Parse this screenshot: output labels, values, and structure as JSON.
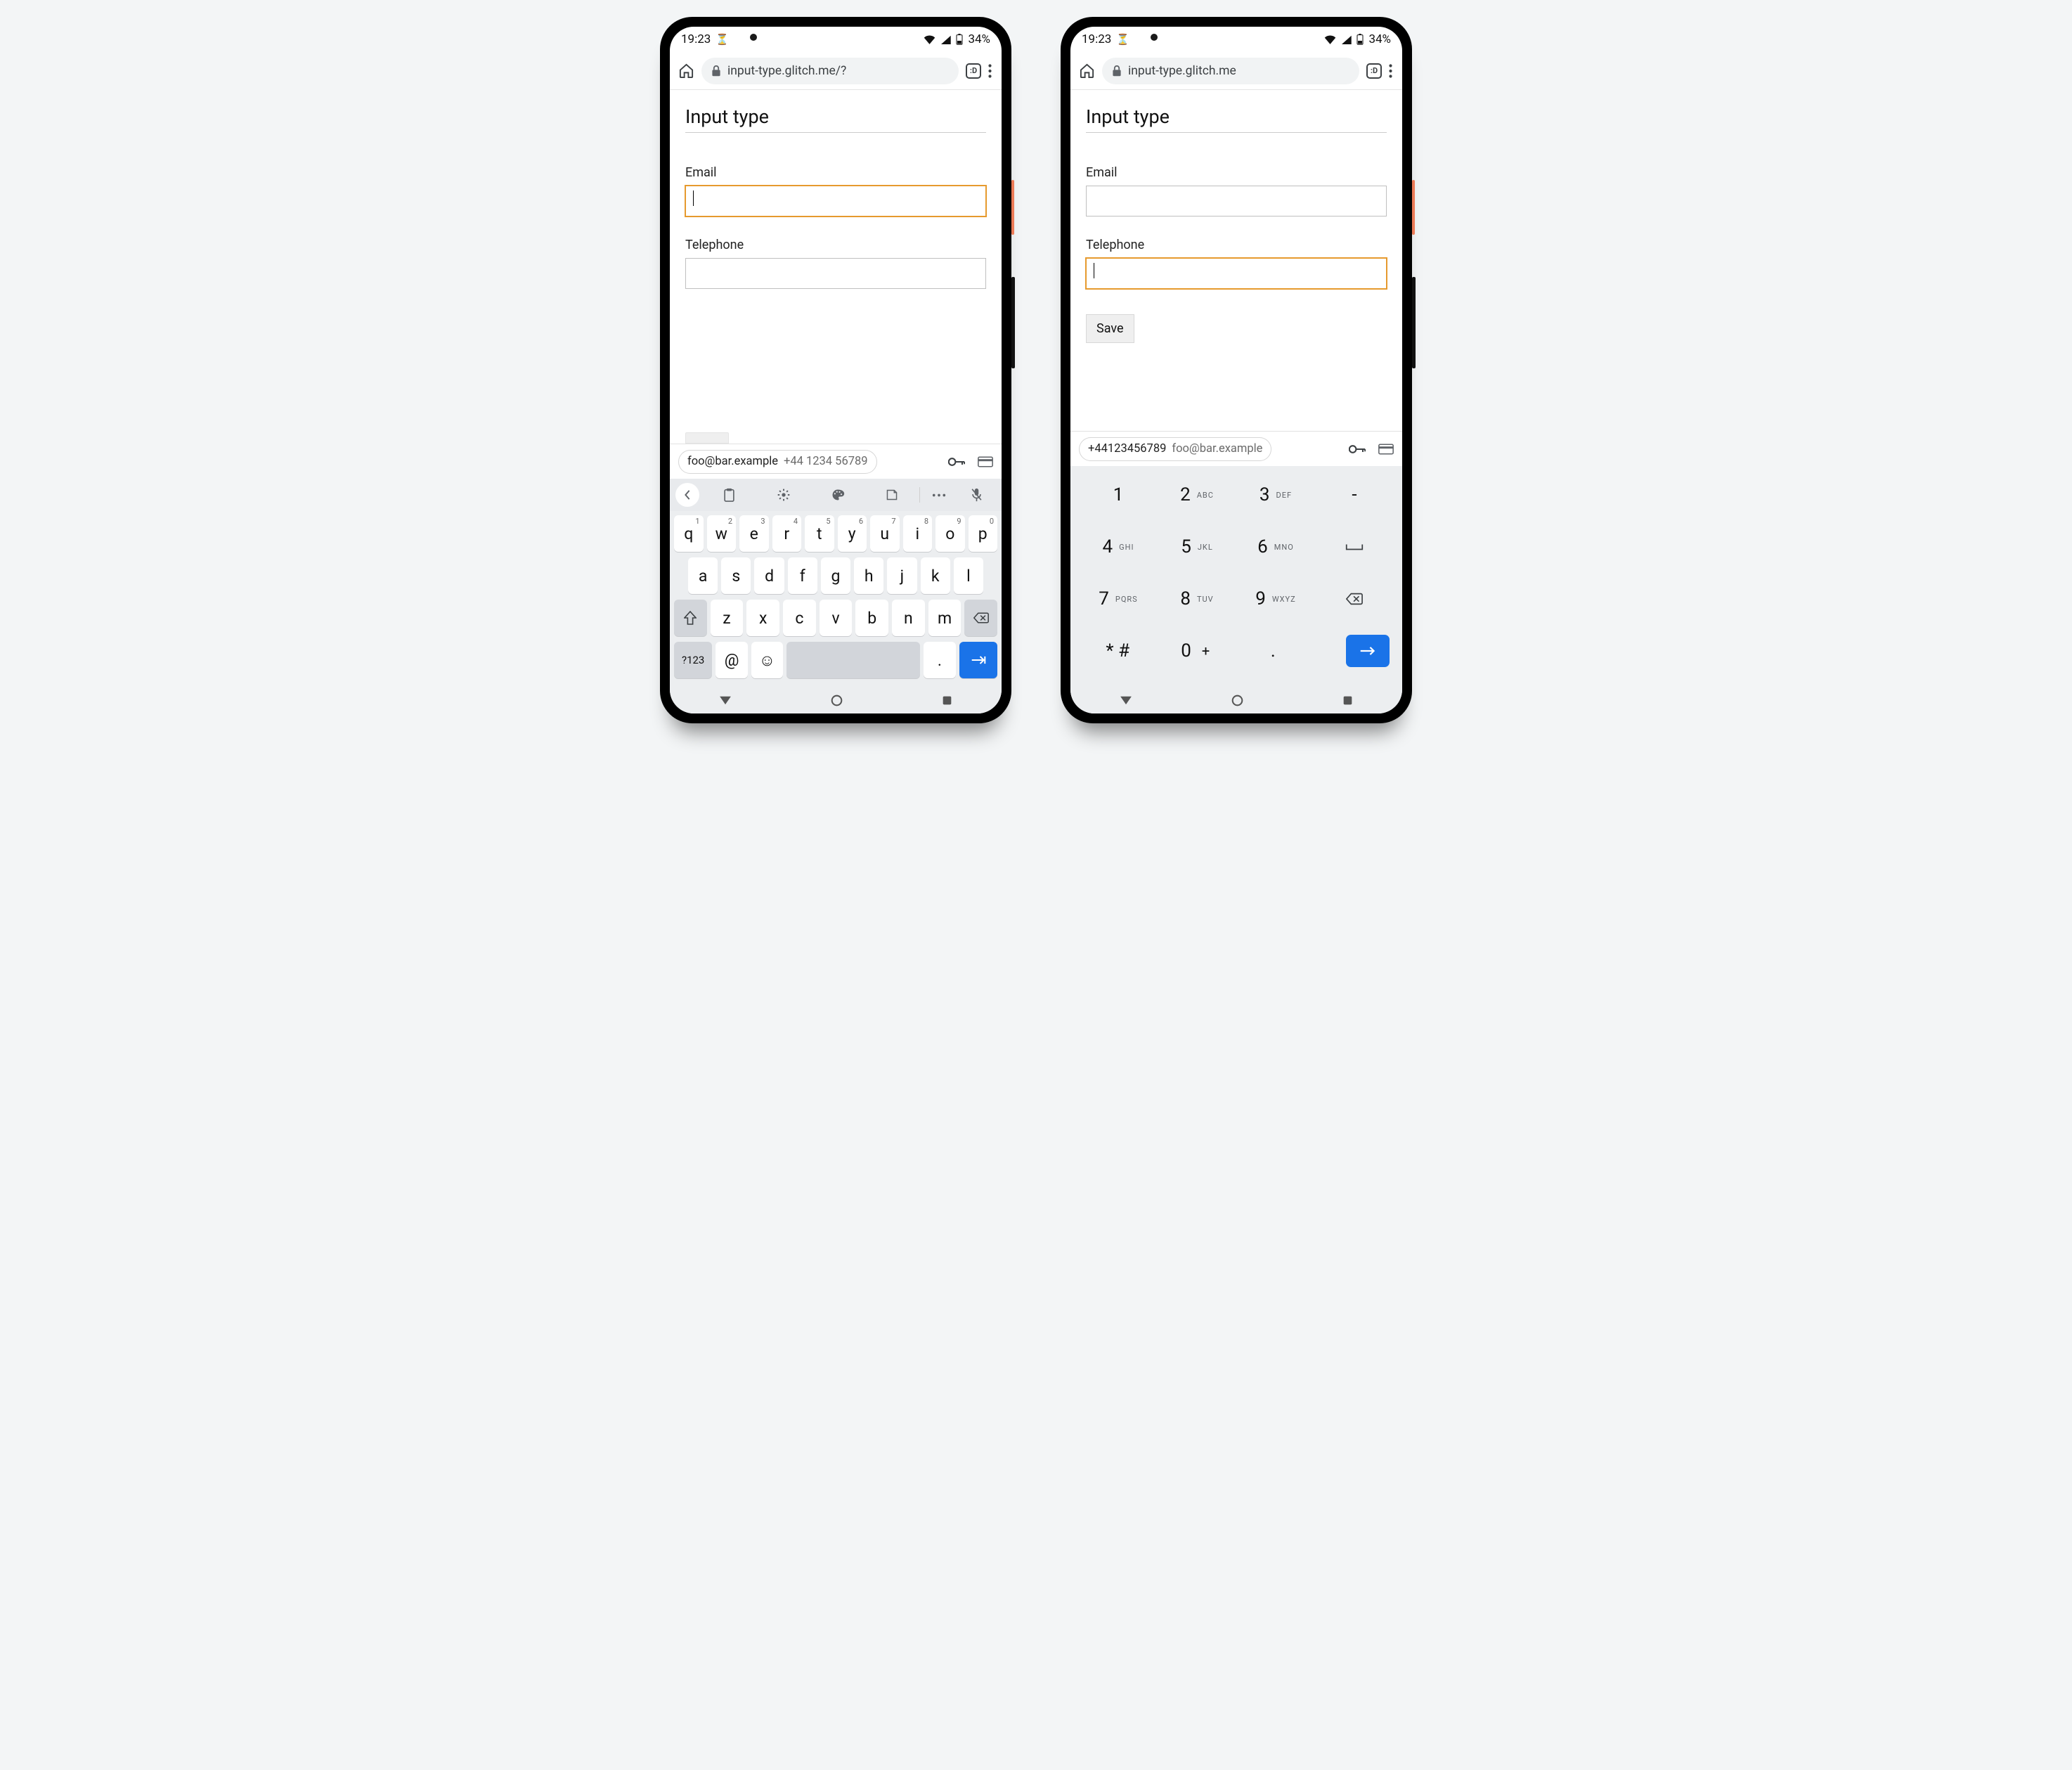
{
  "phones": {
    "left": {
      "status": {
        "time": "19:23",
        "battery": "34%"
      },
      "browser": {
        "url": "input-type.glitch.me/?",
        "tab_badge": ":D"
      },
      "page": {
        "heading": "Input type",
        "email_label": "Email",
        "telephone_label": "Telephone"
      },
      "suggestion": {
        "primary": "foo@bar.example",
        "secondary": "+44 1234 56789"
      },
      "qwerty": {
        "row1": [
          "q",
          "w",
          "e",
          "r",
          "t",
          "y",
          "u",
          "i",
          "o",
          "p"
        ],
        "row1_sup": [
          "1",
          "2",
          "3",
          "4",
          "5",
          "6",
          "7",
          "8",
          "9",
          "0"
        ],
        "row2": [
          "a",
          "s",
          "d",
          "f",
          "g",
          "h",
          "j",
          "k",
          "l"
        ],
        "row3": [
          "z",
          "x",
          "c",
          "v",
          "b",
          "n",
          "m"
        ],
        "sym": "?123",
        "at": "@",
        "dot": "."
      }
    },
    "right": {
      "status": {
        "time": "19:23",
        "battery": "34%"
      },
      "browser": {
        "url": "input-type.glitch.me",
        "tab_badge": ":D"
      },
      "page": {
        "heading": "Input type",
        "email_label": "Email",
        "telephone_label": "Telephone",
        "save_label": "Save"
      },
      "suggestion": {
        "primary": "+44123456789",
        "secondary": "foo@bar.example"
      },
      "numpad": {
        "rows": [
          [
            {
              "d": "1",
              "l": ""
            },
            {
              "d": "2",
              "l": "ABC"
            },
            {
              "d": "3",
              "l": "DEF"
            },
            {
              "d": "-",
              "l": ""
            }
          ],
          [
            {
              "d": "4",
              "l": "GHI"
            },
            {
              "d": "5",
              "l": "JKL"
            },
            {
              "d": "6",
              "l": "MNO"
            },
            {
              "d": "␣",
              "l": ""
            }
          ],
          [
            {
              "d": "7",
              "l": "PQRS"
            },
            {
              "d": "8",
              "l": "TUV"
            },
            {
              "d": "9",
              "l": "WXYZ"
            },
            {
              "d": "⌫",
              "l": ""
            }
          ],
          [
            {
              "d": "* #",
              "l": ""
            },
            {
              "d": "0",
              "a": "+"
            },
            {
              "d": ".",
              "l": ""
            },
            {
              "go": true
            }
          ]
        ]
      }
    }
  }
}
